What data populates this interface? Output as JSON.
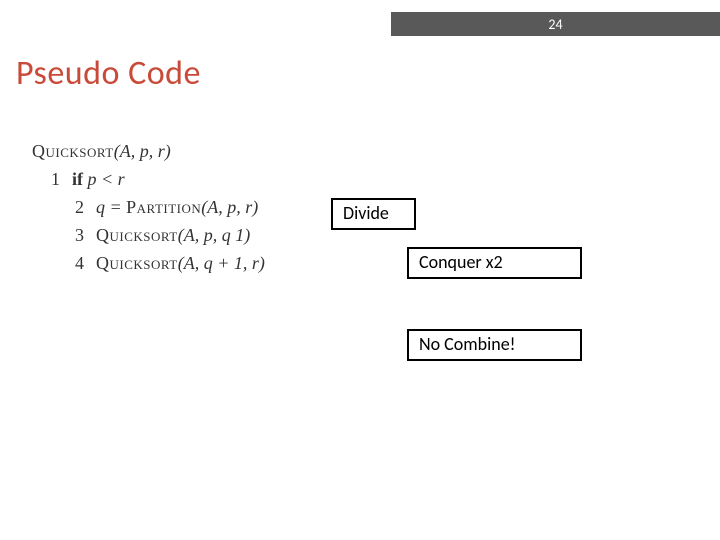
{
  "page_number": "24",
  "title": "Pseudo Code",
  "code": {
    "header": {
      "fn": "Quicksort",
      "args": "(A, p, r)"
    },
    "lines": [
      {
        "n": "1",
        "pre": "if ",
        "rest": "p < r"
      },
      {
        "n": "2",
        "text_a": "q  =  ",
        "fn": "Partition",
        "text_b": "(A, p, r)"
      },
      {
        "n": "3",
        "fn": "Quicksort",
        "text_b": "(A, p, q    1)"
      },
      {
        "n": "4",
        "fn": "Quicksort",
        "text_b": "(A, q + 1, r)"
      }
    ]
  },
  "annotations": {
    "divide": "Divide",
    "conquer": "Conquer x2",
    "combine": "No Combine!"
  }
}
